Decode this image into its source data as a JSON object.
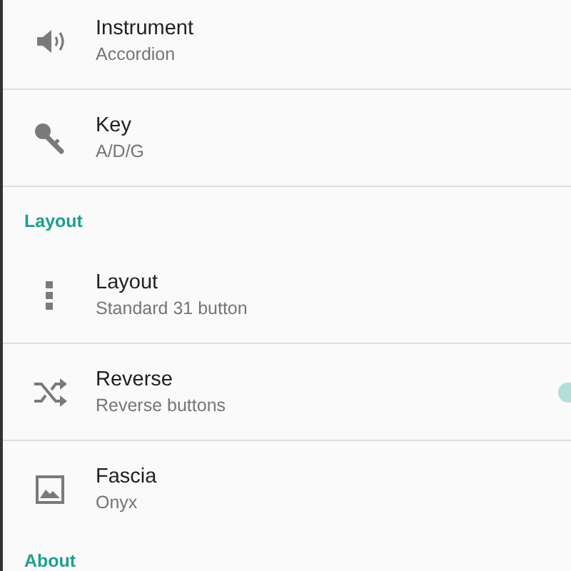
{
  "sections": [
    {
      "items": [
        {
          "kind": "speaker",
          "title": "Instrument",
          "subtitle": "Accordion"
        },
        {
          "kind": "key",
          "title": "Key",
          "subtitle": "A/D/G"
        }
      ]
    },
    {
      "header": "Layout",
      "items": [
        {
          "kind": "dots",
          "title": "Layout",
          "subtitle": "Standard 31 button"
        },
        {
          "kind": "shuffle",
          "title": "Reverse",
          "subtitle": "Reverse buttons",
          "switch": {
            "on": true
          }
        },
        {
          "kind": "image",
          "title": "Fascia",
          "subtitle": "Onyx"
        }
      ]
    },
    {
      "header": "About"
    }
  ]
}
